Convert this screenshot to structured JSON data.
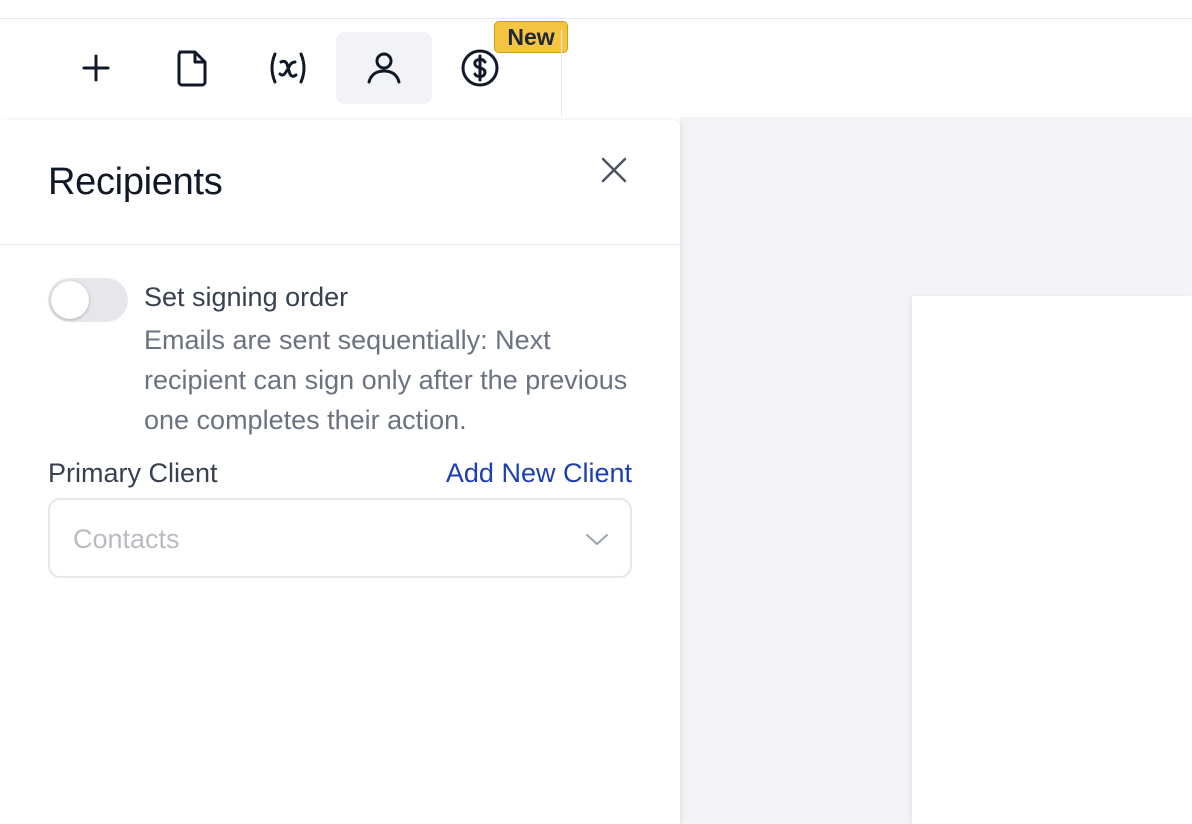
{
  "toolbar": {
    "tools": [
      {
        "name": "add",
        "icon": "plus-icon"
      },
      {
        "name": "document",
        "icon": "file-icon"
      },
      {
        "name": "variables",
        "icon": "variable-icon"
      },
      {
        "name": "recipients",
        "icon": "user-icon",
        "active": true
      },
      {
        "name": "pricing",
        "icon": "dollar-circle-icon"
      }
    ],
    "new_badge": "New"
  },
  "panel": {
    "title": "Recipients",
    "signing_order": {
      "label": "Set signing order",
      "description": "Emails are sent sequentially: Next recipient can sign only after the previous one completes their action.",
      "enabled": false
    },
    "primary_client": {
      "label": "Primary Client",
      "add_link": "Add New Client",
      "select_placeholder": "Contacts"
    }
  },
  "colors": {
    "accent_link": "#1e40af",
    "badge": "#f5c542",
    "canvas_bg": "#f3f4f7"
  }
}
